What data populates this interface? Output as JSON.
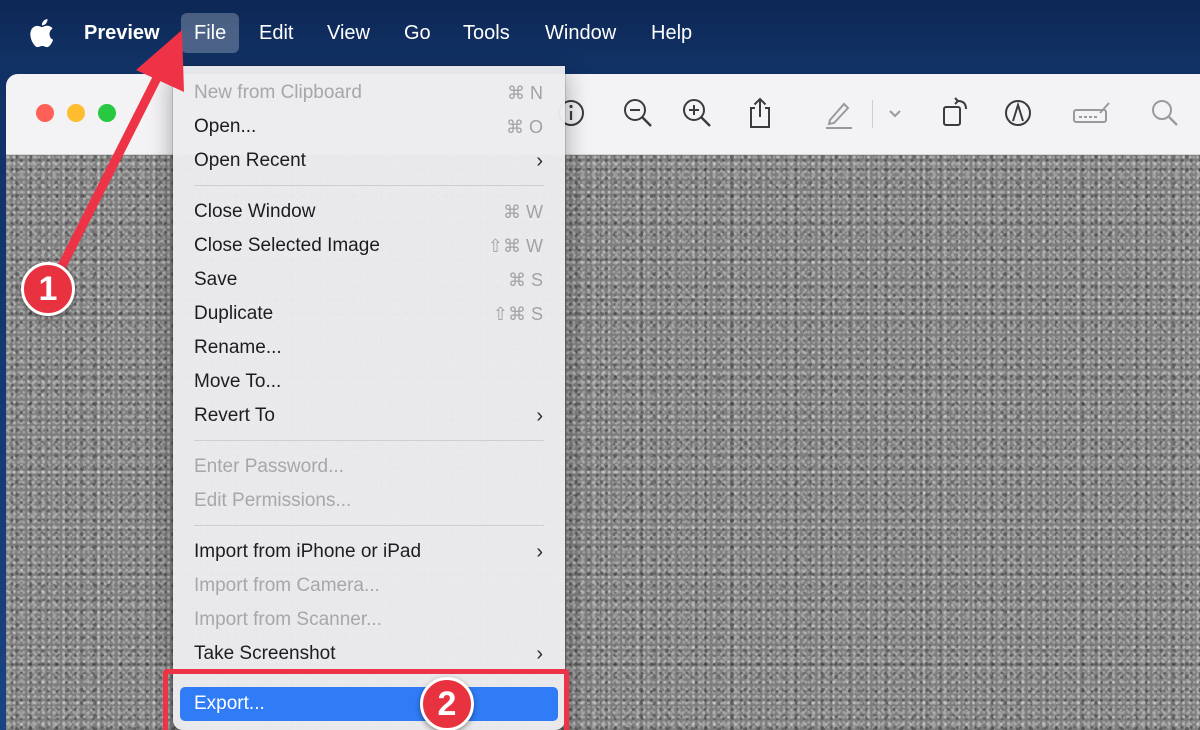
{
  "menubar": {
    "app_name": "Preview",
    "menus": [
      "File",
      "Edit",
      "View",
      "Go",
      "Tools",
      "Window",
      "Help"
    ],
    "active_menu": "File"
  },
  "window": {
    "toolbar_icons": [
      "info-icon",
      "zoom-out-icon",
      "zoom-in-icon",
      "share-icon",
      "highlight-pen-icon",
      "chevron-down-icon",
      "rotate-icon",
      "markup-icon",
      "sign-icon",
      "search-icon"
    ]
  },
  "file_menu": {
    "items": [
      {
        "label": "New from Clipboard",
        "shortcut": "⌘ N",
        "enabled": false
      },
      {
        "label": "Open...",
        "shortcut": "⌘ O",
        "enabled": true
      },
      {
        "label": "Open Recent",
        "submenu": true,
        "enabled": true
      },
      {
        "label": "Close Window",
        "shortcut": "⌘ W",
        "enabled": true
      },
      {
        "label": "Close Selected Image",
        "shortcut": "⇧⌘ W",
        "enabled": true
      },
      {
        "label": "Save",
        "shortcut": "⌘ S",
        "enabled": true
      },
      {
        "label": "Duplicate",
        "shortcut": "⇧⌘ S",
        "enabled": true
      },
      {
        "label": "Rename...",
        "enabled": true
      },
      {
        "label": "Move To...",
        "enabled": true
      },
      {
        "label": "Revert To",
        "submenu": true,
        "enabled": true
      },
      {
        "label": "Enter Password...",
        "enabled": false
      },
      {
        "label": "Edit Permissions...",
        "enabled": false
      },
      {
        "label": "Import from iPhone or iPad",
        "submenu": true,
        "enabled": true
      },
      {
        "label": "Import from Camera...",
        "enabled": false
      },
      {
        "label": "Import from Scanner...",
        "enabled": false
      },
      {
        "label": "Take Screenshot",
        "submenu": true,
        "enabled": true
      },
      {
        "label": "Export...",
        "enabled": true,
        "highlighted": true
      }
    ],
    "chevron": "›"
  },
  "annotations": {
    "step1": "1",
    "step2": "2",
    "color": "#e8323f"
  },
  "colors": {
    "menubar": "#123266",
    "highlight": "#2f7cf6",
    "annotation": "#ee3347"
  }
}
